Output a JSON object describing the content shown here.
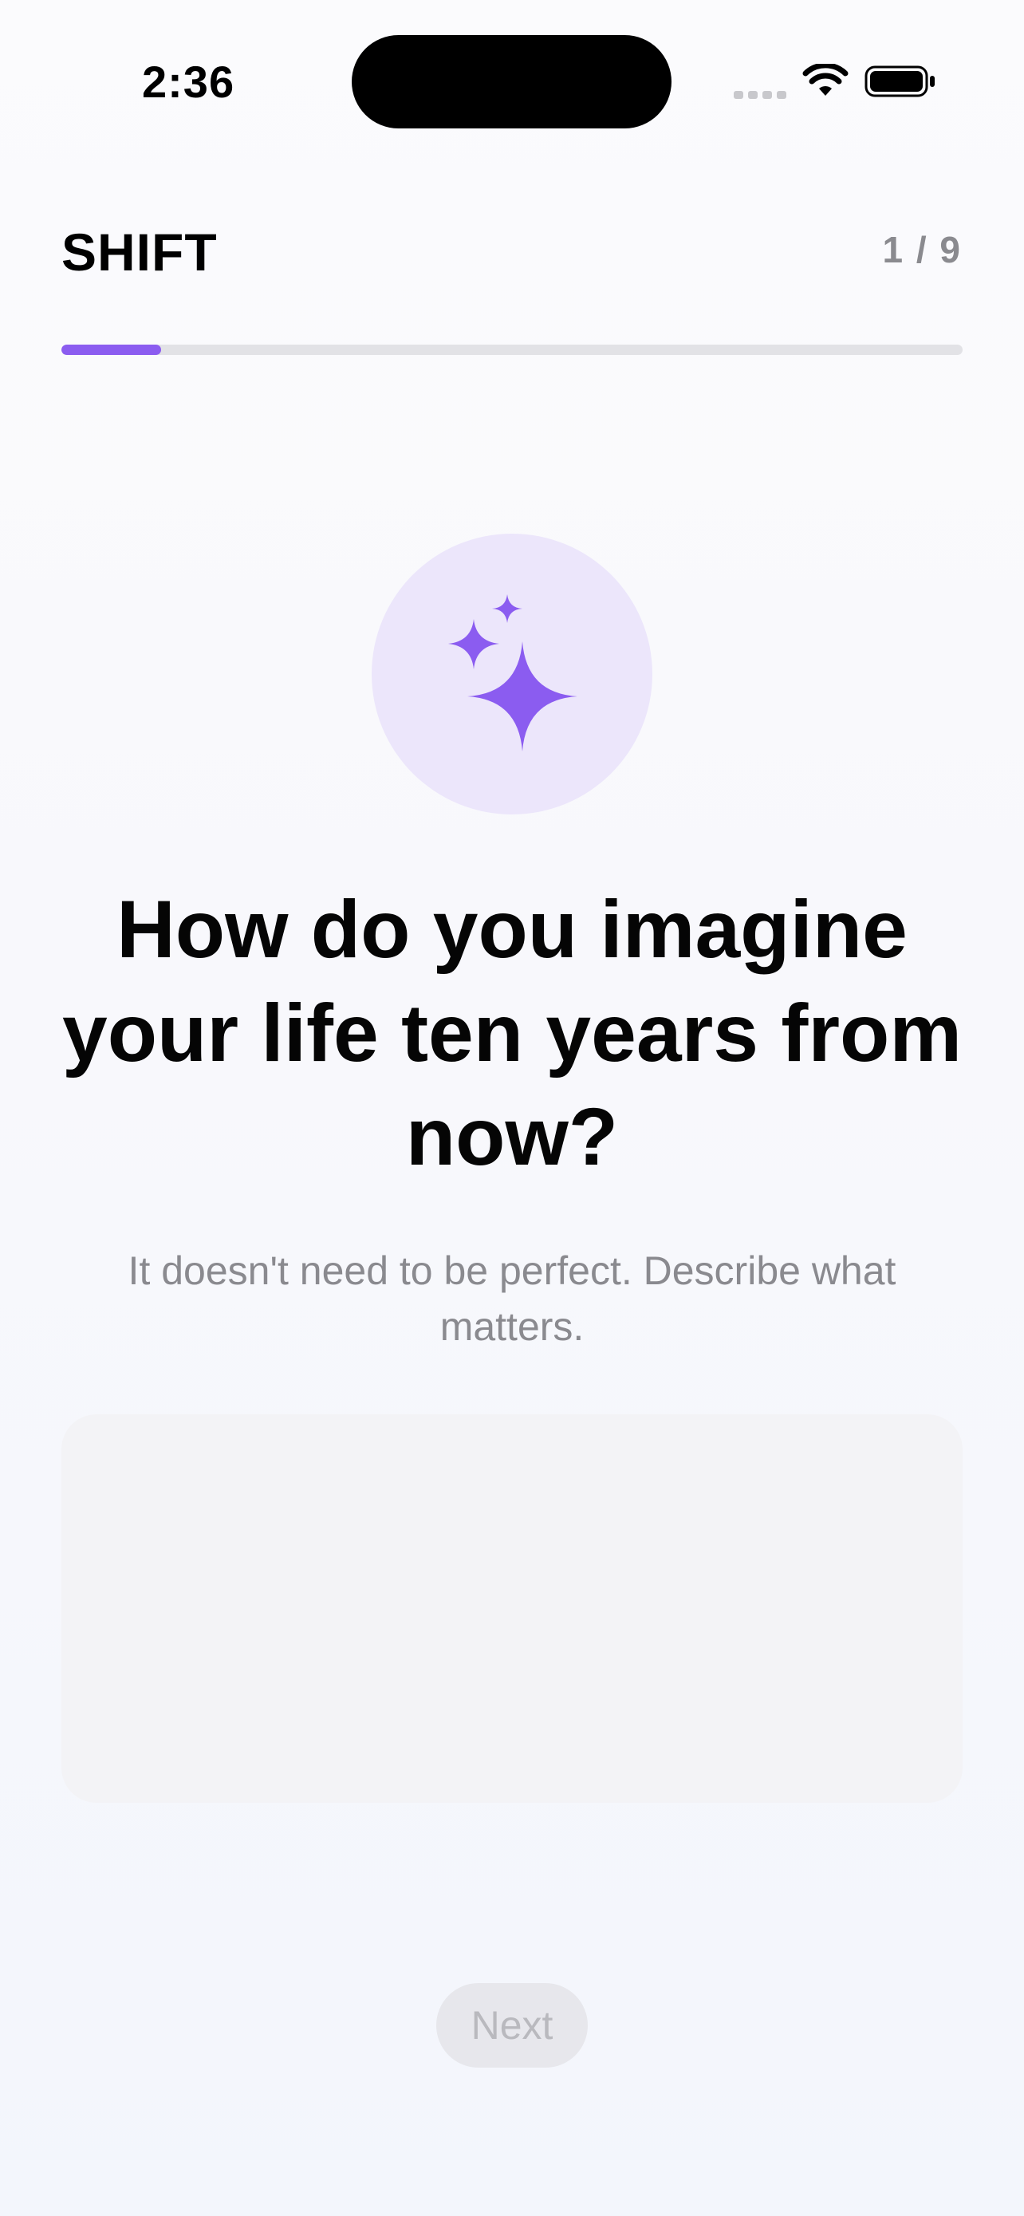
{
  "status_bar": {
    "time": "2:36"
  },
  "header": {
    "brand": "SHIFT",
    "step_counter": "1 / 9",
    "progress_fraction": 0.111,
    "accent_color": "#8b5cf0"
  },
  "question": {
    "icon": "sparkles-icon",
    "title": "How do you imagine your life ten years from now?",
    "hint": "It doesn't need to be perfect. Describe what matters."
  },
  "answer": {
    "value": "",
    "placeholder": ""
  },
  "footer": {
    "next_label": "Next"
  }
}
